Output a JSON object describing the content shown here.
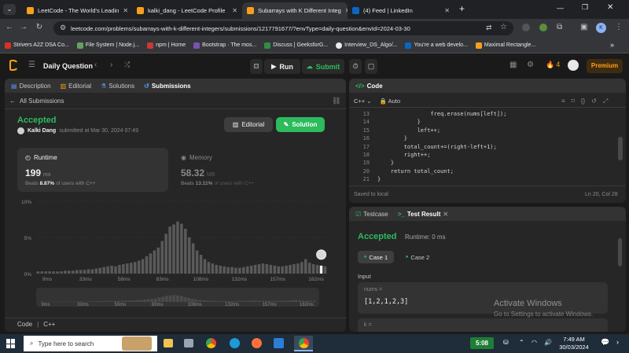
{
  "browser": {
    "tabs": [
      {
        "title": "LeetCode - The World's Leadin",
        "color": "#f89f1b",
        "active": false
      },
      {
        "title": "kalki_dang - LeetCode Profile",
        "color": "#f89f1b",
        "active": false
      },
      {
        "title": "Subarrays with K Different Integ",
        "color": "#f89f1b",
        "active": true
      },
      {
        "title": "(4) Feed | LinkedIn",
        "color": "#0a66c2",
        "active": false
      }
    ],
    "new_tab": "+",
    "url": "leetcode.com/problems/subarrays-with-k-different-integers/submissions/1217791677/?envType=daily-question&envId=2024-03-30",
    "bookmarks": [
      {
        "label": "Strivers A2Z DSA Co...",
        "color": "#d93025"
      },
      {
        "label": "File System | Node.j...",
        "color": "#68a063"
      },
      {
        "label": "npm | Home",
        "color": "#cb3837"
      },
      {
        "label": "Bootstrap · The mos...",
        "color": "#7952b3"
      },
      {
        "label": "Discuss | GeeksforG...",
        "color": "#2f8d46"
      },
      {
        "label": "Interview_DS_Algo/...",
        "color": "#e8eaed"
      },
      {
        "label": "You're a web develo...",
        "color": "#0a66c2"
      },
      {
        "label": "Maximal Rectangle...",
        "color": "#f89f1b"
      }
    ],
    "more": "»"
  },
  "header": {
    "title": "Daily Question",
    "run": "Run",
    "submit": "Submit",
    "streak": "4",
    "premium": "Premium"
  },
  "left": {
    "tabs": [
      "Description",
      "Editorial",
      "Solutions",
      "Submissions"
    ],
    "all_submissions": "All Submissions",
    "status": "Accepted",
    "user": "Kalki Dang",
    "submitted": "submitted at Mar 30, 2024 07:49",
    "editorial_btn": "Editorial",
    "solution_btn": "Solution",
    "runtime": {
      "label": "Runtime",
      "value": "199",
      "unit": "ms",
      "beats_pre": "Beats",
      "beats_pct": "8.87%",
      "beats_post": "of users with C++"
    },
    "memory": {
      "label": "Memory",
      "value": "58.32",
      "unit": "MB",
      "beats_pre": "Beats",
      "beats_pct": "13.11%",
      "beats_post": "of users with C++"
    },
    "footer": {
      "code": "Code",
      "lang": "C++"
    }
  },
  "chart_data": {
    "type": "bar",
    "ylabels": [
      "10%",
      "5%",
      "0%"
    ],
    "ylim": [
      0,
      10
    ],
    "xlabels": [
      "9ms",
      "33ms",
      "58ms",
      "83ms",
      "108ms",
      "132ms",
      "157ms",
      "182ms"
    ],
    "values": [
      0.3,
      0.3,
      0.3,
      0.3,
      0.3,
      0.3,
      0.3,
      0.4,
      0.4,
      0.4,
      0.5,
      0.5,
      0.5,
      0.6,
      0.6,
      0.7,
      0.8,
      0.9,
      1.0,
      1.1,
      1.0,
      1.2,
      1.3,
      1.4,
      1.5,
      1.6,
      1.8,
      2.0,
      2.4,
      2.8,
      3.2,
      3.6,
      4.5,
      5.5,
      6.5,
      6.8,
      7.2,
      6.9,
      6.2,
      5.0,
      4.2,
      3.2,
      2.6,
      2.0,
      1.6,
      1.4,
      1.2,
      1.1,
      1.0,
      0.9,
      0.9,
      0.8,
      0.8,
      0.9,
      1.0,
      1.1,
      1.2,
      1.3,
      1.4,
      1.3,
      1.2,
      1.1,
      1.0,
      1.0,
      1.1,
      1.2,
      1.3,
      1.4,
      1.6,
      2.0,
      1.5,
      1.3,
      1.2,
      1.1,
      1.0
    ],
    "highlight_index": 73,
    "mini_xlabels": [
      "9ms",
      "33ms",
      "50ms",
      "83ms",
      "108ms",
      "132ms",
      "157ms",
      "182ms"
    ]
  },
  "code_panel": {
    "title": "Code",
    "lang": "C++",
    "mode": "Auto",
    "lines": [
      {
        "n": "13",
        "text": "                freq.erase(nums[left]);"
      },
      {
        "n": "14",
        "text": "            }"
      },
      {
        "n": "15",
        "text": "            left++;"
      },
      {
        "n": "16",
        "text": "        }"
      },
      {
        "n": "17",
        "text": "        total_count+=(right-left+1);"
      },
      {
        "n": "18",
        "text": "        right++;"
      },
      {
        "n": "19",
        "text": "    }"
      },
      {
        "n": "20",
        "text": "    return total_count;"
      },
      {
        "n": "21",
        "text": "}"
      }
    ],
    "saved": "Saved to local",
    "position": "Ln 20, Col 28"
  },
  "result_panel": {
    "tabs": [
      "Testcase",
      "Test Result"
    ],
    "status": "Accepted",
    "runtime": "Runtime: 0 ms",
    "cases": [
      "Case 1",
      "Case 2"
    ],
    "input_label": "Input",
    "var1": "nums =",
    "val1": "[1,2,1,2,3]",
    "var2": "k ="
  },
  "watermark": {
    "line1": "Activate Windows",
    "line2": "Go to Settings to activate Windows."
  },
  "taskbar": {
    "search": "Type here to search",
    "time": "7:49 AM",
    "date": "30/03/2024",
    "widget": "5:08"
  }
}
